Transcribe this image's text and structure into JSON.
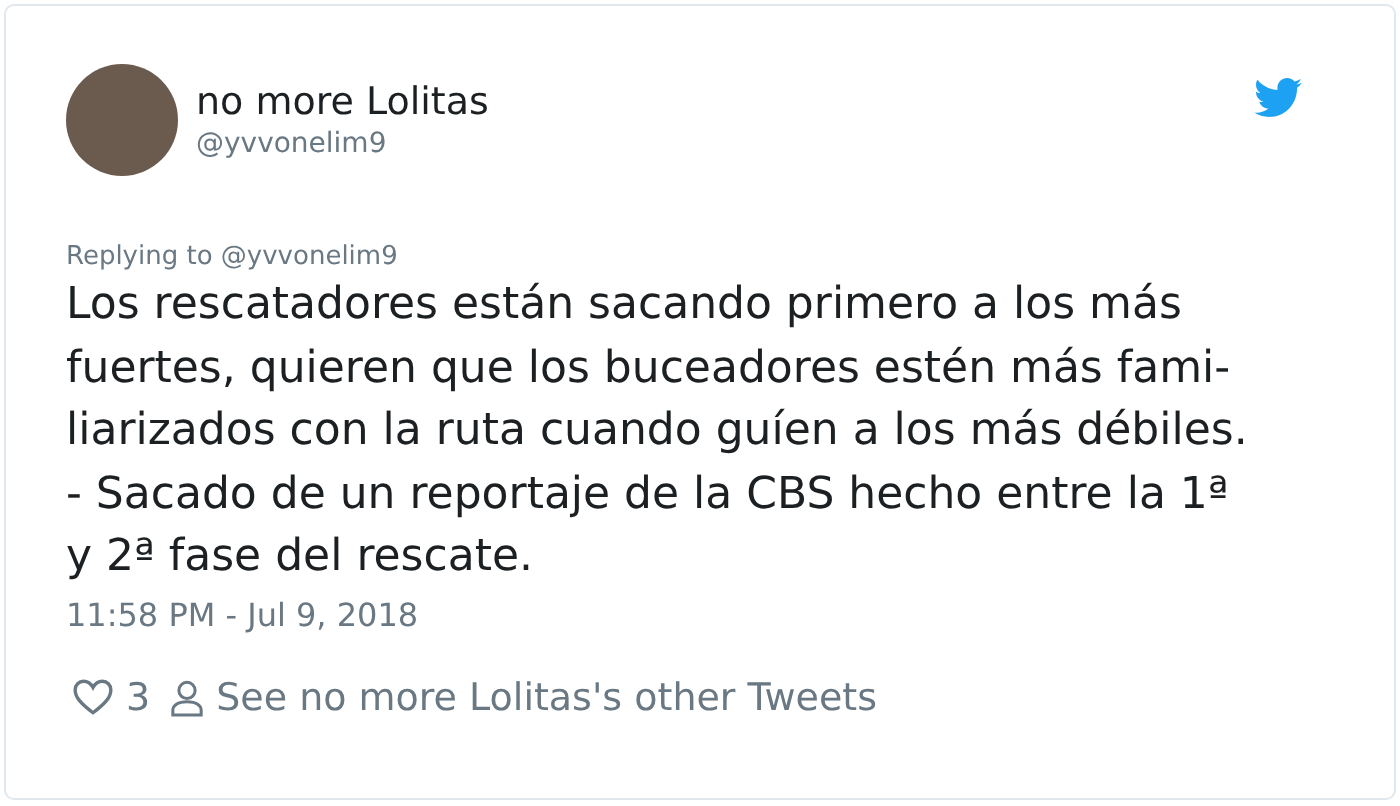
{
  "tweet": {
    "author": {
      "name": "no more Lolitas",
      "handle": "@yvvonelim9"
    },
    "replying_to": "Replying to @yvvonelim9",
    "body_lines": [
      "Los rescatadores están sacando primero a los más",
      "fuertes, quieren que los buceadores estén más fami-",
      "liarizados con la ruta cuando guíen a los más débiles.",
      "- Sacado de un reportaje de la CBS hecho entre la 1ª",
      "y 2ª fase del rescate."
    ],
    "timestamp": "11:58 PM - Jul 9, 2018",
    "likes": "3",
    "profile_link": "See no more Lolitas's other Tweets"
  }
}
